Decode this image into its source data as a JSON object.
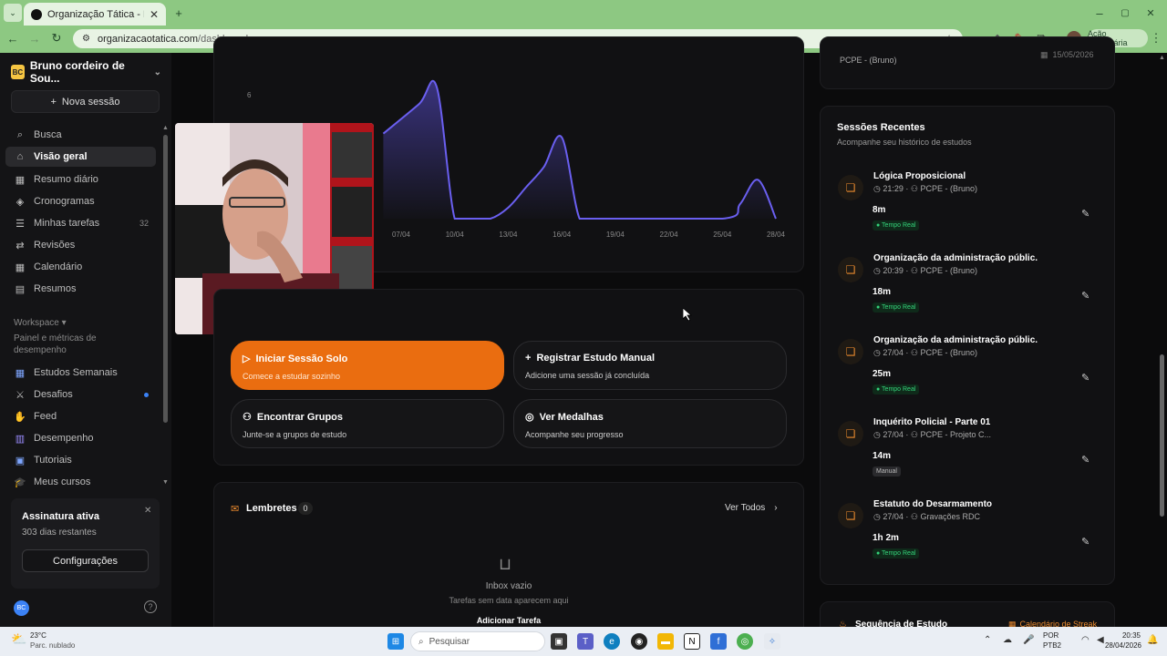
{
  "browser": {
    "tab_title": "Organização Tática - Plataforma",
    "url_host": "organizacaotatica.com",
    "url_path": "/dashboard",
    "action_pill": "Ação necessária"
  },
  "sidebar": {
    "workspace_badge": "BC",
    "workspace_name": "Bruno cordeiro de Sou...",
    "new_session": "Nova sessão",
    "items": [
      {
        "label": "Busca",
        "icon": "search-icon"
      },
      {
        "label": "Visão geral",
        "icon": "home-icon",
        "active": true
      },
      {
        "label": "Resumo diário",
        "icon": "calendar-icon"
      },
      {
        "label": "Cronogramas",
        "icon": "layers-icon"
      },
      {
        "label": "Minhas tarefas",
        "icon": "list-icon",
        "count": "32"
      },
      {
        "label": "Revisões",
        "icon": "refresh-icon"
      },
      {
        "label": "Calendário",
        "icon": "calendar-icon"
      },
      {
        "label": "Resumos",
        "icon": "document-icon"
      }
    ],
    "workspace_label": "Workspace ▾",
    "workspace_desc": "Painel e métricas de desempenho",
    "sub_items": [
      {
        "label": "Estudos Semanais",
        "icon": "calendar-icon"
      },
      {
        "label": "Desafios",
        "icon": "swords-icon",
        "dot": true
      },
      {
        "label": "Feed",
        "icon": "wave-icon"
      },
      {
        "label": "Desempenho",
        "icon": "chart-icon"
      },
      {
        "label": "Tutoriais",
        "icon": "book-icon"
      },
      {
        "label": "Meus cursos",
        "icon": "graduation-icon"
      }
    ],
    "subscription": {
      "title": "Assinatura ativa",
      "days": "303 dias restantes",
      "button": "Configurações"
    },
    "avatar": "BC"
  },
  "chart_data": {
    "type": "area",
    "x_ticks": [
      "07/04",
      "10/04",
      "13/04",
      "16/04",
      "19/04",
      "22/04",
      "25/04",
      "28/04"
    ],
    "y_tick_visible": "6",
    "series": [
      {
        "x": [
          "06/04",
          "08/04",
          "09/04",
          "10/04",
          "11/04",
          "12/04",
          "13/04",
          "14/04",
          "15/04",
          "16/04",
          "17/04",
          "18/04",
          "25/04",
          "26/04",
          "27/04",
          "28/04"
        ],
        "values": [
          4.6,
          6.2,
          7.1,
          0,
          0,
          0,
          0.6,
          1.7,
          2.8,
          4.4,
          0,
          0,
          0,
          0.8,
          2.1,
          0
        ]
      }
    ]
  },
  "actions": [
    {
      "title": "Iniciar Sessão Solo",
      "subtitle": "Comece a estudar sozinho",
      "icon": "play-icon",
      "primary": true
    },
    {
      "title": "Registrar Estudo Manual",
      "subtitle": "Adicione uma sessão já concluída",
      "icon": "plus-icon"
    },
    {
      "title": "Encontrar Grupos",
      "subtitle": "Junte-se a grupos de estudo",
      "icon": "users-icon"
    },
    {
      "title": "Ver Medalhas",
      "subtitle": "Acompanhe seu progresso",
      "icon": "medal-icon"
    }
  ],
  "reminders": {
    "title": "Lembretes",
    "count": "0",
    "see_all": "Ver Todos",
    "empty_title": "Inbox vazio",
    "empty_desc": "Tarefas sem data aparecem aqui",
    "add_button": "Adicionar Tarefa"
  },
  "top_card": {
    "subtitle": "PCPE - (Bruno)",
    "date": "15/05/2026"
  },
  "recent": {
    "title": "Sessões Recentes",
    "subtitle": "Acompanhe seu histórico de estudos",
    "sessions": [
      {
        "title": "Lógica Proposicional",
        "time": "21:29",
        "group": "PCPE - (Bruno)",
        "duration": "8m",
        "tag": "Tempo Real",
        "tag_type": "real"
      },
      {
        "title": "Organização da administração públic...",
        "time": "20:39",
        "group": "PCPE - (Bruno)",
        "duration": "18m",
        "tag": "Tempo Real",
        "tag_type": "real"
      },
      {
        "title": "Organização da administração públic...",
        "time": "27/04",
        "group": "PCPE - (Bruno)",
        "duration": "25m",
        "tag": "Tempo Real",
        "tag_type": "real"
      },
      {
        "title": "Inquérito Policial - Parte 01",
        "time": "27/04",
        "group": "PCPE - Projeto C...",
        "duration": "14m",
        "tag": "Manual",
        "tag_type": "manual"
      },
      {
        "title": "Estatuto do Desarmamento",
        "time": "27/04",
        "group": "Gravações RDC",
        "duration": "1h 2m",
        "tag": "Tempo Real",
        "tag_type": "real"
      }
    ]
  },
  "streak": {
    "title": "Sequência de Estudo",
    "link": "Calendário de Streak"
  },
  "taskbar": {
    "weather_temp": "23°C",
    "weather_desc": "Parc. nublado",
    "search": "Pesquisar",
    "lang": "POR",
    "layout": "PTB2",
    "time": "20:35",
    "date": "28/04/2026"
  }
}
